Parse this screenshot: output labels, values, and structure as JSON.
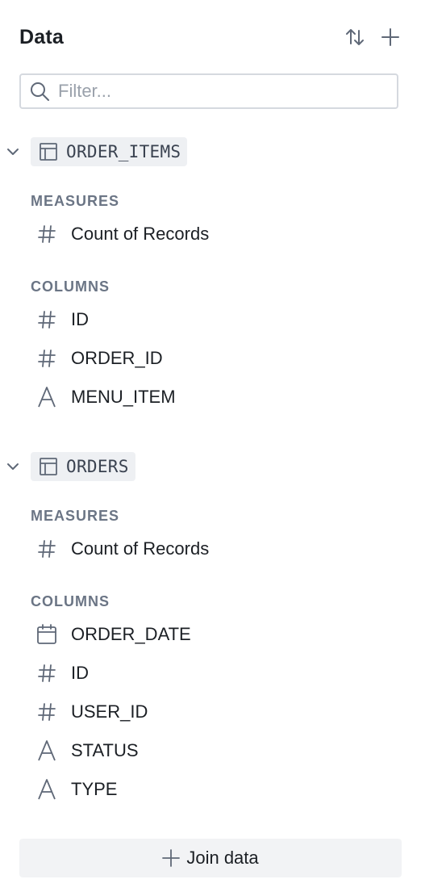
{
  "panel": {
    "title": "Data",
    "sort_icon": "sort-arrows-icon",
    "add_icon": "plus-icon"
  },
  "search": {
    "placeholder": "Filter...",
    "value": ""
  },
  "tables": [
    {
      "name": "ORDER_ITEMS",
      "expanded": true,
      "measures_label": "MEASURES",
      "measures": [
        {
          "label": "Count of Records",
          "type": "number"
        }
      ],
      "columns_label": "COLUMNS",
      "columns": [
        {
          "label": "ID",
          "type": "number"
        },
        {
          "label": "ORDER_ID",
          "type": "number"
        },
        {
          "label": "MENU_ITEM",
          "type": "text"
        }
      ]
    },
    {
      "name": "ORDERS",
      "expanded": true,
      "measures_label": "MEASURES",
      "measures": [
        {
          "label": "Count of Records",
          "type": "number"
        }
      ],
      "columns_label": "COLUMNS",
      "columns": [
        {
          "label": "ORDER_DATE",
          "type": "date"
        },
        {
          "label": "ID",
          "type": "number"
        },
        {
          "label": "USER_ID",
          "type": "number"
        },
        {
          "label": "STATUS",
          "type": "text"
        },
        {
          "label": "TYPE",
          "type": "text"
        }
      ]
    }
  ],
  "join_button": {
    "label": "Join data"
  },
  "colors": {
    "icon": "#5f6877",
    "group_label": "#6b7585",
    "chip_bg": "#eef0f3",
    "button_bg": "#f2f3f5",
    "input_border": "#d5d9df"
  }
}
